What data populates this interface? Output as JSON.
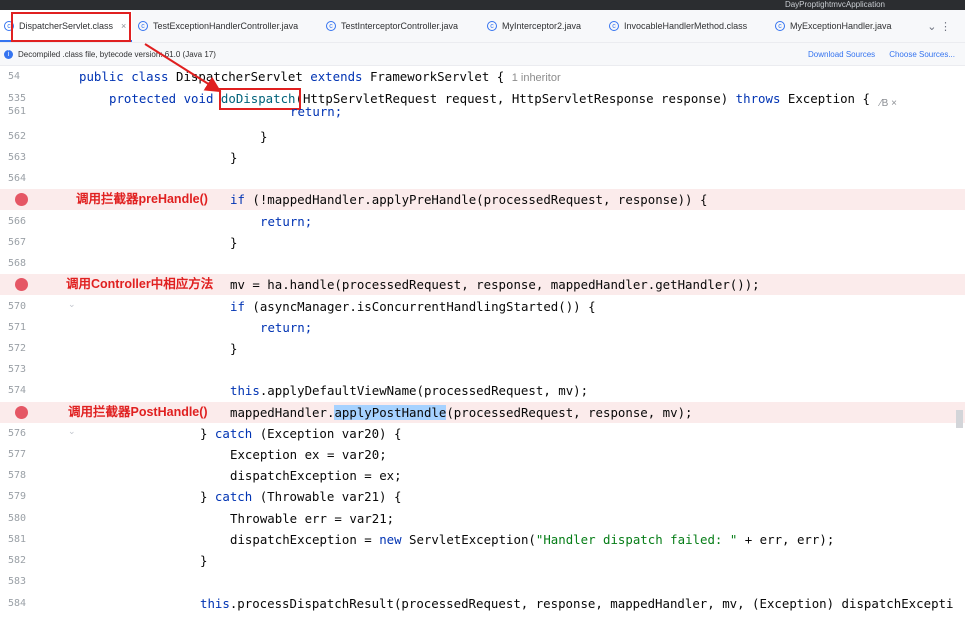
{
  "window": {
    "run_config": "DayProptightmvcApplication"
  },
  "tabs": [
    {
      "label": "DispatcherServlet.class",
      "icon": "class-icon",
      "active": true,
      "close": "×"
    },
    {
      "label": "TestExceptionHandlerController.java",
      "icon": "class-icon"
    },
    {
      "label": "TestInterceptorController.java",
      "icon": "class-icon"
    },
    {
      "label": "MyInterceptor2.java",
      "icon": "class-icon"
    },
    {
      "label": "InvocableHandlerMethod.class",
      "icon": "class-icon"
    },
    {
      "label": "MyExceptionHandler.java",
      "icon": "class-icon"
    }
  ],
  "tab_more": "⌄ ⋮",
  "info_bar": {
    "text": "Decompiled .class file, bytecode version: 61.0 (Java 17)",
    "download": "Download Sources",
    "choose": "Choose Sources..."
  },
  "hover_hint": "⁄B ×",
  "annotations": {
    "prehandle": "调用拦截器preHandle()",
    "controller": "调用Controller中相应方法",
    "posthandle": "调用拦截器PostHandle()"
  },
  "gutter": [
    "54",
    "535",
    "561",
    "562",
    "563",
    "564",
    "",
    "566",
    "567",
    "568",
    "",
    "570",
    "571",
    "572",
    "573",
    "574",
    "",
    "576",
    "577",
    "578",
    "579",
    "580",
    "581",
    "582",
    "583",
    "584"
  ],
  "code": {
    "l54a": "public class ",
    "l54b": "DispatcherServlet ",
    "l54c": "extends ",
    "l54d": "FrameworkServlet { ",
    "l54e": "1 inheritor",
    "l535a": "protected void ",
    "l535b": "doDispatch",
    "l535c": "(HttpServletRequest request, HttpServletResponse response) ",
    "l535d": "throws ",
    "l535e": "Exception {",
    "l561": "return;",
    "l562": "}",
    "l563": "}",
    "l565a": "if ",
    "l565b": "(!mappedHandler.applyPreHandle(processedRequest, response)) {",
    "l566": "return;",
    "l567": "}",
    "l569": "mv = ha.handle(processedRequest, response, mappedHandler.getHandler());",
    "l570a": "if ",
    "l570b": "(asyncManager.isConcurrentHandlingStarted()) {",
    "l571": "return;",
    "l572": "}",
    "l574a": "this",
    "l574b": ".applyDefaultViewName(processedRequest, mv);",
    "l575a": "mappedHandler.",
    "l575b": "applyPostHandle",
    "l575c": "(processedRequest, response, mv);",
    "l576a": "} ",
    "l576b": "catch ",
    "l576c": "(Exception var20) {",
    "l577": "Exception ex = var20;",
    "l578": "dispatchException = ex;",
    "l579a": "} ",
    "l579b": "catch ",
    "l579c": "(Throwable var21) {",
    "l580": "Throwable err = var21;",
    "l581a": "dispatchException = ",
    "l581b": "new ",
    "l581c": "ServletException(",
    "l581d": "\"Handler dispatch failed: \"",
    "l581e": " + err, err);",
    "l582": "}",
    "l584a": "this",
    "l584b": ".processDispatchResult(processedRequest, response, mappedHandler, mv, (Exception) dispatchExcepti"
  },
  "colors": {
    "accent": "#3574f0",
    "annotation_red": "#e02020",
    "breakpoint": "#e55765",
    "breakpoint_line": "#fbebeb"
  }
}
